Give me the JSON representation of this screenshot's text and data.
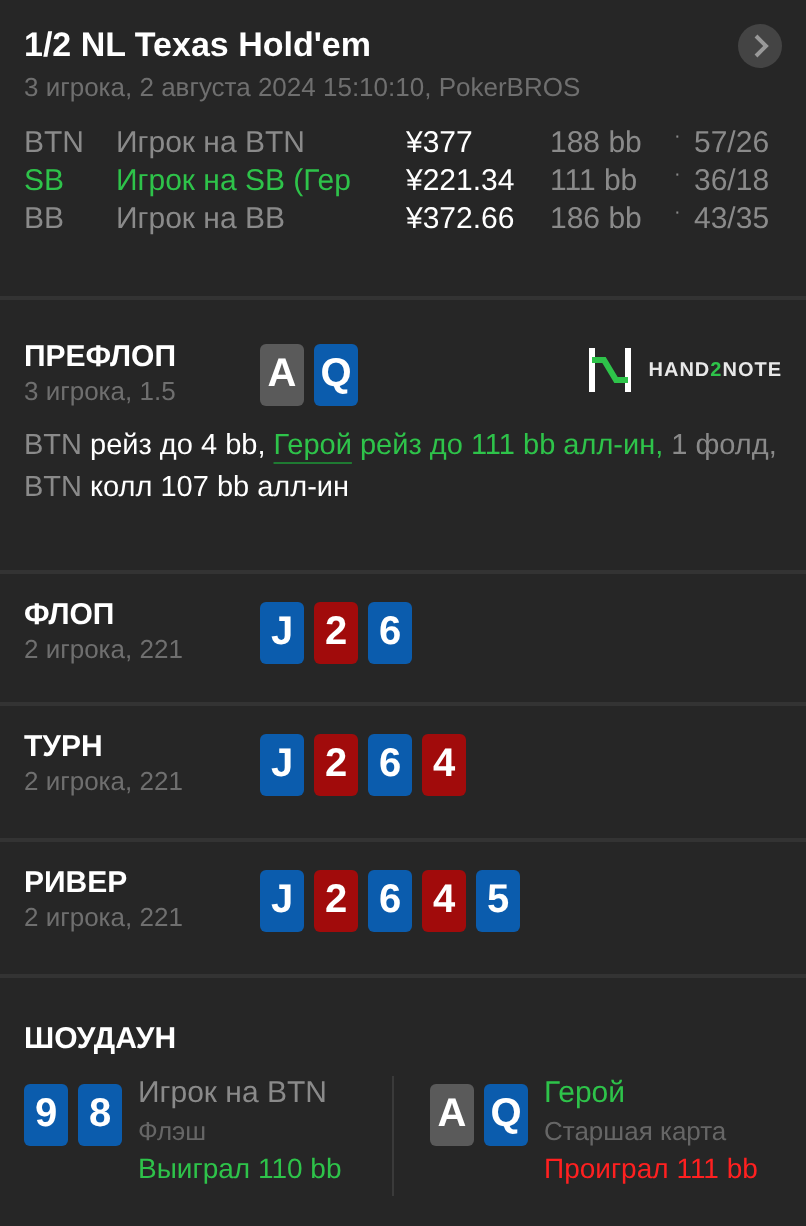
{
  "header": {
    "title": "1/2 NL Texas Hold'em",
    "subtitle": "3 игрока, 2 августа 2024 15:10:10, PokerBROS",
    "next_button": true,
    "players": [
      {
        "position": "BTN",
        "name": "Игрок на BTN",
        "hero": false,
        "stack": "¥377",
        "bb": "188 bb",
        "separator": "·",
        "stats": "57/26"
      },
      {
        "position": "SB",
        "name": "Игрок на SB (Гер",
        "hero": true,
        "stack": "¥221.34",
        "bb": "111 bb",
        "separator": "·",
        "stats": "36/18"
      },
      {
        "position": "BB",
        "name": "Игрок на BB",
        "hero": false,
        "stack": "¥372.66",
        "bb": "186 bb",
        "separator": "·",
        "stats": "43/35"
      }
    ]
  },
  "streets": [
    {
      "title": "ПРЕФЛОП",
      "subtitle": "3 игрока, 1.5",
      "cards": [
        {
          "rank": "A",
          "color": "#5a5a5a"
        },
        {
          "rank": "Q",
          "color": "#0b5cad"
        }
      ],
      "logo": {
        "parts": [
          {
            "text": "HAND",
            "accent": false
          },
          {
            "text": "2",
            "accent": true
          },
          {
            "text": "NOTE",
            "accent": false
          }
        ]
      },
      "actions": [
        {
          "text": "BTN",
          "kind": "position"
        },
        {
          "text": " рейз до 4 bb, ",
          "kind": "action"
        },
        {
          "text": "Герой",
          "kind": "hero-link"
        },
        {
          "text": " рейз до 111 bb алл-ин, ",
          "kind": "hero"
        },
        {
          "text": "1 фолд, BTN",
          "kind": "position"
        },
        {
          "text": " колл 107 bb алл-ин",
          "kind": "action"
        }
      ]
    },
    {
      "title": "ФЛОП",
      "subtitle": "2 игрока, 221",
      "cards": [
        {
          "rank": "J",
          "color": "#0b5cad"
        },
        {
          "rank": "2",
          "color": "#a10b0b"
        },
        {
          "rank": "6",
          "color": "#0b5cad"
        }
      ]
    },
    {
      "title": "ТУРН",
      "subtitle": "2 игрока, 221",
      "cards": [
        {
          "rank": "J",
          "color": "#0b5cad"
        },
        {
          "rank": "2",
          "color": "#a10b0b"
        },
        {
          "rank": "6",
          "color": "#0b5cad"
        },
        {
          "rank": "4",
          "color": "#a10b0b"
        }
      ]
    },
    {
      "title": "РИВЕР",
      "subtitle": "2 игрока, 221",
      "cards": [
        {
          "rank": "J",
          "color": "#0b5cad"
        },
        {
          "rank": "2",
          "color": "#a10b0b"
        },
        {
          "rank": "6",
          "color": "#0b5cad"
        },
        {
          "rank": "4",
          "color": "#a10b0b"
        },
        {
          "rank": "5",
          "color": "#0b5cad"
        }
      ]
    }
  ],
  "showdown": {
    "title": "ШОУДАУН",
    "hands": [
      {
        "cards": [
          {
            "rank": "9",
            "color": "#0b5cad"
          },
          {
            "rank": "8",
            "color": "#0b5cad"
          }
        ],
        "name": "Игрок на BTN",
        "hero": false,
        "hand": "Флэш",
        "result": "Выиграл 110 bb",
        "won": true
      },
      {
        "cards": [
          {
            "rank": "A",
            "color": "#5a5a5a"
          },
          {
            "rank": "Q",
            "color": "#0b5cad"
          }
        ],
        "name": "Герой",
        "hero": true,
        "hand": "Старшая карта",
        "result": "Проиграл 111 bb",
        "won": false
      }
    ]
  }
}
